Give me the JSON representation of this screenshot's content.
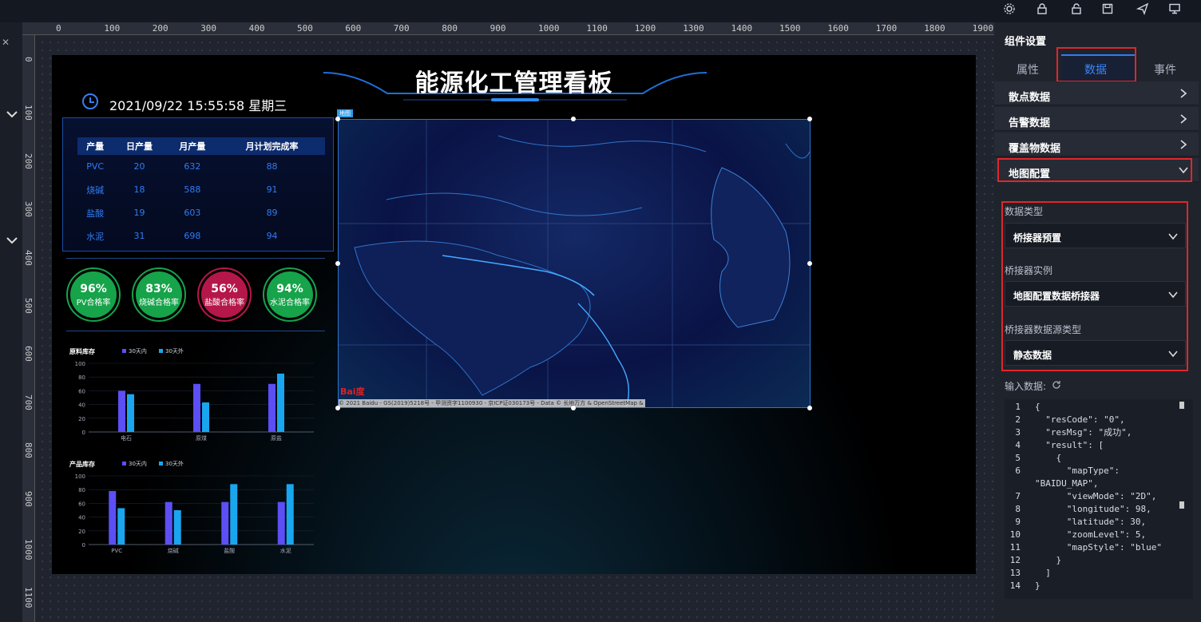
{
  "toolbar": {
    "icons": [
      "gear-icon",
      "lock-icon",
      "unlock-icon",
      "save-icon",
      "send-icon",
      "monitor-icon"
    ]
  },
  "ruler": {
    "h": [
      "0",
      "100",
      "200",
      "300",
      "400",
      "500",
      "600",
      "700",
      "800",
      "900",
      "1000",
      "1100",
      "1200",
      "1300",
      "1400",
      "1500",
      "1600",
      "1700",
      "1800",
      "1900"
    ],
    "v": [
      "0",
      "100",
      "200",
      "300",
      "400",
      "500",
      "600",
      "700",
      "800",
      "900",
      "1000",
      "1100"
    ]
  },
  "dashboard": {
    "title": "能源化工管理看板",
    "datetime": "2021/09/22 15:55:58 星期三",
    "table": {
      "headers": [
        "产量",
        "日产量",
        "月产量",
        "月计划完成率"
      ],
      "rows": [
        [
          "PVC",
          "20",
          "632",
          "88"
        ],
        [
          "烧碱",
          "18",
          "588",
          "91"
        ],
        [
          "盐酸",
          "19",
          "603",
          "89"
        ],
        [
          "水泥",
          "31",
          "698",
          "94"
        ]
      ]
    },
    "gauges": [
      {
        "pct": "96%",
        "label": "PV合格率",
        "color": "#16a34a"
      },
      {
        "pct": "83%",
        "label": "烧碱合格率",
        "color": "#16a34a"
      },
      {
        "pct": "56%",
        "label": "盐酸合格率",
        "color": "#b5174a"
      },
      {
        "pct": "94%",
        "label": "水泥合格率",
        "color": "#16a34a"
      }
    ],
    "map": {
      "tag": "地图",
      "footer": "© 2021 Baidu - GS(2019)5218号 - 甲测资字1100930 - 京ICP证030173号 - Data © 长地万方 & OpenStreetMap & HERE",
      "logo": "Bai度"
    }
  },
  "chart_data": [
    {
      "type": "bar",
      "title": "原料库存",
      "categories": [
        "电石",
        "原煤",
        "原盐"
      ],
      "series": [
        {
          "name": "30天内",
          "values": [
            60,
            70,
            70
          ],
          "color": "#5b4ff5"
        },
        {
          "name": "30天外",
          "values": [
            55,
            43,
            85
          ],
          "color": "#19a6ef"
        }
      ],
      "ylim": [
        0,
        100
      ],
      "yticks": [
        "0",
        "20",
        "40",
        "60",
        "80",
        "100"
      ]
    },
    {
      "type": "bar",
      "title": "产品库存",
      "categories": [
        "PVC",
        "烧碱",
        "盐酸",
        "水泥"
      ],
      "series": [
        {
          "name": "30天内",
          "values": [
            78,
            62,
            62,
            62
          ],
          "color": "#5b4ff5"
        },
        {
          "name": "30天外",
          "values": [
            53,
            50,
            88,
            88
          ],
          "color": "#19a6ef"
        }
      ],
      "ylim": [
        0,
        100
      ],
      "yticks": [
        "0",
        "20",
        "40",
        "60",
        "80",
        "100"
      ]
    }
  ],
  "panel": {
    "title": "组件设置",
    "tabs": [
      "属性",
      "数据",
      "事件"
    ],
    "accordion": [
      "散点数据",
      "告警数据",
      "覆盖物数据",
      "地图配置"
    ],
    "fields": [
      {
        "label": "数据类型",
        "value": "桥接器预置"
      },
      {
        "label": "桥接器实例",
        "value": "地图配置数据桥接器"
      },
      {
        "label": "桥接器数据源类型",
        "value": "静态数据"
      }
    ],
    "input_label": "输入数据:",
    "code_lines": [
      "{",
      "  \"resCode\": \"0\",",
      "  \"resMsg\": \"成功\",",
      "  \"result\": [",
      "    {",
      "      \"mapType\":",
      "\"BAIDU_MAP\",",
      "      \"viewMode\": \"2D\",",
      "      \"longitude\": 98,",
      "      \"latitude\": 30,",
      "      \"zoomLevel\": 5,",
      "      \"mapStyle\": \"blue\"",
      "    }",
      "  ]",
      "}"
    ],
    "code_numbers": [
      "1",
      "2",
      "3",
      "4",
      "5",
      "6",
      "",
      "7",
      "8",
      "9",
      "10",
      "11",
      "12",
      "13",
      "14"
    ]
  }
}
